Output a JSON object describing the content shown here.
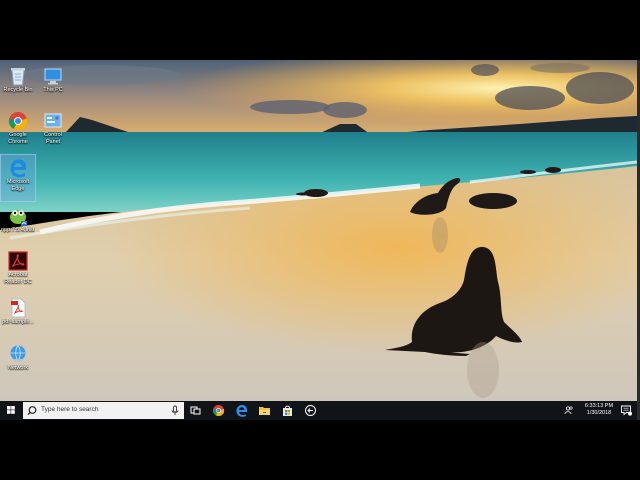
{
  "desktop": {
    "icons": [
      {
        "name": "recycle-bin",
        "label": "Recycle Bin"
      },
      {
        "name": "this-pc",
        "label": "This PC"
      },
      {
        "name": "google-chrome",
        "label": "Google Chrome"
      },
      {
        "name": "control-panel",
        "label": "Control Panel"
      },
      {
        "name": "microsoft-edge",
        "label": "Microsoft Edge"
      },
      {
        "name": "npp",
        "label": "npp.7.5.4.Inst..."
      },
      {
        "name": "acrobat-reader",
        "label": "Acrobat Reader DC"
      },
      {
        "name": "pdf-sample",
        "label": "pdf-sample..."
      },
      {
        "name": "network",
        "label": "Network"
      }
    ],
    "label_lines": {
      "chrome": [
        "Google",
        "Chrome"
      ],
      "control_panel": [
        "Control",
        "Panel"
      ],
      "edge": [
        "Microsoft",
        "Edge"
      ],
      "acrobat": [
        "Acrobat",
        "Reader DC"
      ]
    }
  },
  "taskbar": {
    "search_placeholder": "Type here to search",
    "pinned": [
      "task-view-icon",
      "chrome-icon",
      "edge-icon",
      "file-explorer-icon",
      "store-icon",
      "back-arrow-icon"
    ],
    "clock_time": "6:33:13 PM",
    "clock_date": "1/30/2018"
  },
  "colors": {
    "taskbar": "#101418",
    "search_box": "#f2f2f2",
    "sky_top": "#5a6f86",
    "sunset": "#f4b24a",
    "sea": "#2a9aa0",
    "sand": "#d8c8a8"
  }
}
